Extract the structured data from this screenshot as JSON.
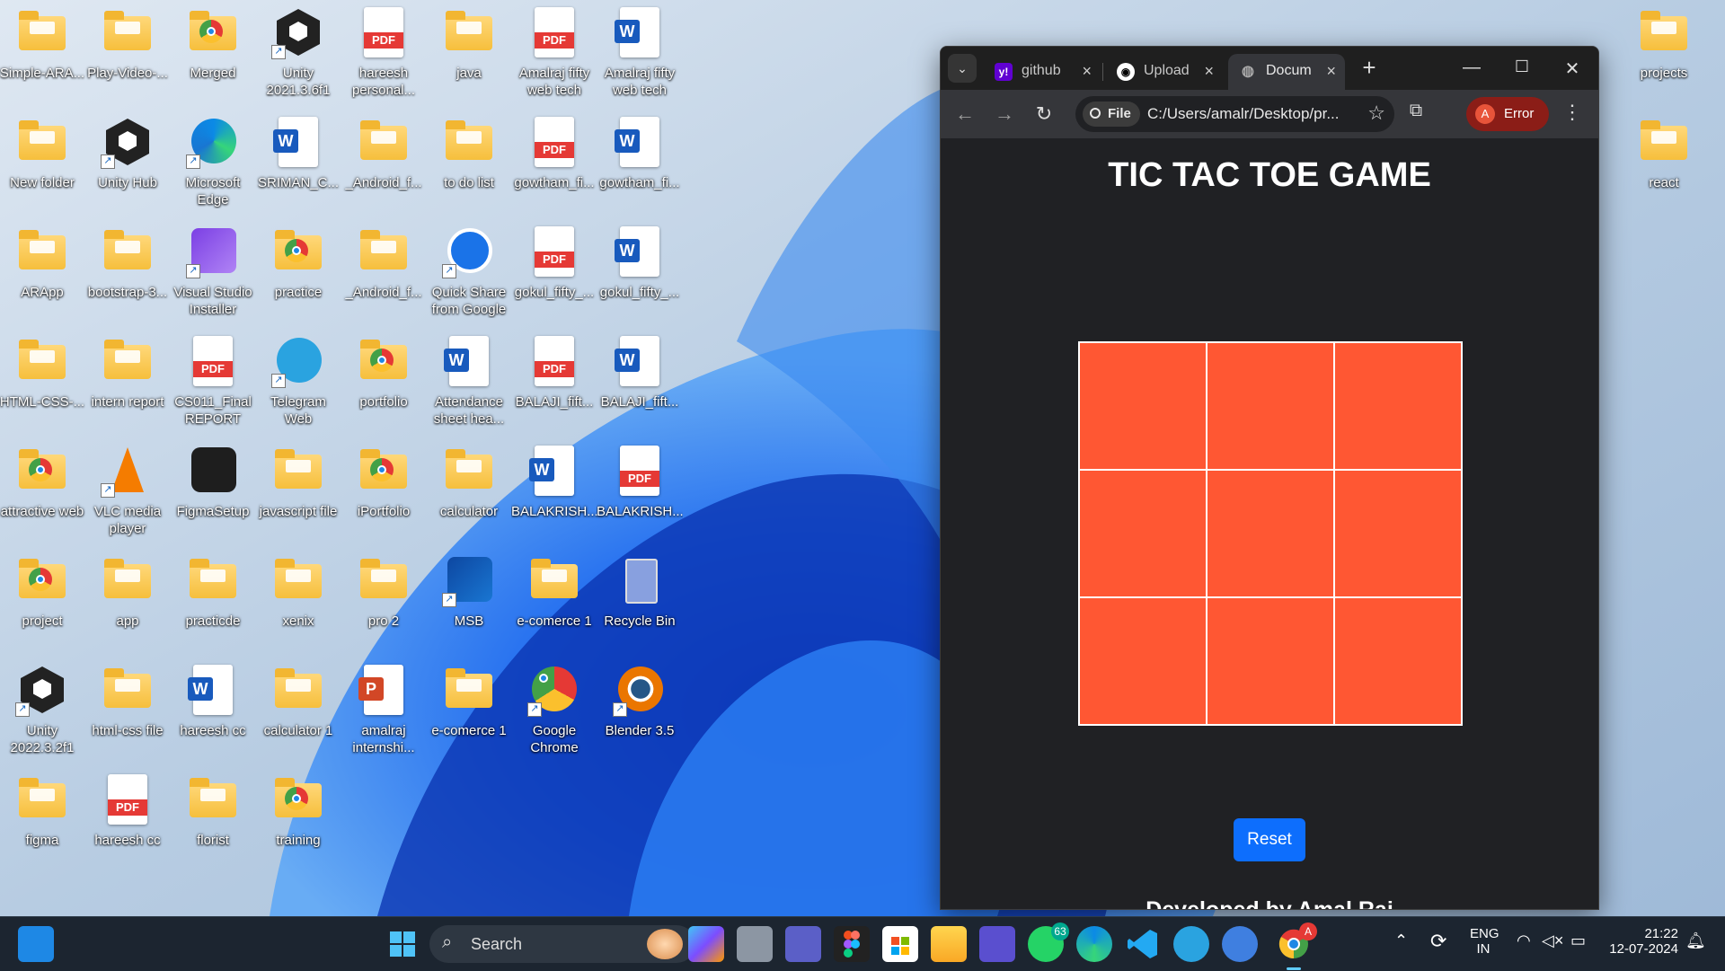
{
  "desktop": {
    "icons": [
      {
        "label": "Simple-ARA...",
        "type": "folder"
      },
      {
        "label": "Play-Video-...",
        "type": "folder"
      },
      {
        "label": "Merged",
        "type": "folder-chrome"
      },
      {
        "label": "Unity 2021.3.6f1",
        "type": "unity"
      },
      {
        "label": "hareesh personal...",
        "type": "pdf"
      },
      {
        "label": "java",
        "type": "folder"
      },
      {
        "label": "Amalraj fifty web tech",
        "type": "pdf"
      },
      {
        "label": "Amalraj fifty web tech",
        "type": "word"
      },
      {
        "label": "New folder",
        "type": "folder"
      },
      {
        "label": "Unity Hub",
        "type": "unity"
      },
      {
        "label": "Microsoft Edge",
        "type": "edge"
      },
      {
        "label": "SRIMAN_C...",
        "type": "word"
      },
      {
        "label": "_Android_f...",
        "type": "folder"
      },
      {
        "label": "to do list",
        "type": "folder"
      },
      {
        "label": "gowtham_fi...",
        "type": "pdf"
      },
      {
        "label": "gowtham_fi...",
        "type": "word"
      },
      {
        "label": "ARApp",
        "type": "folder"
      },
      {
        "label": "bootstrap-3...",
        "type": "folder"
      },
      {
        "label": "Visual Studio Installer",
        "type": "vs"
      },
      {
        "label": "practice",
        "type": "folder-chrome"
      },
      {
        "label": "_Android_f...",
        "type": "folder"
      },
      {
        "label": "Quick Share from Google",
        "type": "quickshare"
      },
      {
        "label": "gokul_fifty_...",
        "type": "pdf"
      },
      {
        "label": "gokul_fifty_...",
        "type": "word"
      },
      {
        "label": "HTML-CSS-...",
        "type": "folder"
      },
      {
        "label": "intern report",
        "type": "folder"
      },
      {
        "label": "CS011_Final REPORT",
        "type": "pdf"
      },
      {
        "label": "Telegram Web",
        "type": "telegram"
      },
      {
        "label": "portfolio",
        "type": "folder-chrome"
      },
      {
        "label": "Attendance sheet hea...",
        "type": "word"
      },
      {
        "label": "BALAJI_fift...",
        "type": "pdf"
      },
      {
        "label": "BALAJI_fift...",
        "type": "word"
      },
      {
        "label": "attractive web",
        "type": "folder-chrome"
      },
      {
        "label": "VLC media player",
        "type": "vlc"
      },
      {
        "label": "FigmaSetup",
        "type": "figma"
      },
      {
        "label": "javascript file",
        "type": "folder"
      },
      {
        "label": "iPortfolio",
        "type": "folder-chrome"
      },
      {
        "label": "calculator",
        "type": "folder"
      },
      {
        "label": "BALAKRISH...",
        "type": "word"
      },
      {
        "label": "BALAKRISH...",
        "type": "pdf"
      },
      {
        "label": "project",
        "type": "folder-chrome"
      },
      {
        "label": "app",
        "type": "folder"
      },
      {
        "label": "practicde",
        "type": "folder"
      },
      {
        "label": "xenix",
        "type": "folder"
      },
      {
        "label": "pro 2",
        "type": "folder"
      },
      {
        "label": "MSB",
        "type": "msb"
      },
      {
        "label": "e-comerce 1",
        "type": "folder"
      },
      {
        "label": "Recycle Bin",
        "type": "recycle"
      },
      {
        "label": "Unity 2022.3.2f1",
        "type": "unity"
      },
      {
        "label": "html-css file",
        "type": "folder"
      },
      {
        "label": "hareesh cc",
        "type": "word"
      },
      {
        "label": "calculator 1",
        "type": "folder"
      },
      {
        "label": "amalraj internshi...",
        "type": "ppt"
      },
      {
        "label": "e-comerce 1",
        "type": "folder"
      },
      {
        "label": "Google Chrome",
        "type": "chrome"
      },
      {
        "label": "Blender 3.5",
        "type": "blender"
      },
      {
        "label": "figma",
        "type": "folder"
      },
      {
        "label": "hareesh cc",
        "type": "pdf"
      },
      {
        "label": "florist",
        "type": "folder"
      },
      {
        "label": "training",
        "type": "folder-chrome"
      },
      {
        "label": "projects",
        "type": "folder"
      },
      {
        "label": "react",
        "type": "folder"
      }
    ]
  },
  "browser": {
    "tabs": [
      {
        "label": "github",
        "icon": "yahoo-icon",
        "active": false
      },
      {
        "label": "Upload",
        "icon": "github-icon",
        "active": false
      },
      {
        "label": "Docum",
        "icon": "globe-icon",
        "active": true
      }
    ],
    "new_tab": "+",
    "address_chip": "File",
    "url": "C:/Users/amalr/Desktop/pr...",
    "profile_initial": "A",
    "profile_status": "Error"
  },
  "page": {
    "title": "TIC TAC TOE GAME",
    "board_cells": [
      "",
      "",
      "",
      "",
      "",
      "",
      "",
      "",
      ""
    ],
    "reset_label": "Reset",
    "credit": "Developed by Amal Raj"
  },
  "colors": {
    "board": "#ff5733",
    "button": "#0d6efd",
    "page_bg": "#202124"
  },
  "taskbar": {
    "search_label": "Search",
    "whatsapp_badge": "63",
    "chrome_badge": "A",
    "lang_top": "ENG",
    "lang_bottom": "IN",
    "time": "21:22",
    "date": "12-07-2024"
  }
}
